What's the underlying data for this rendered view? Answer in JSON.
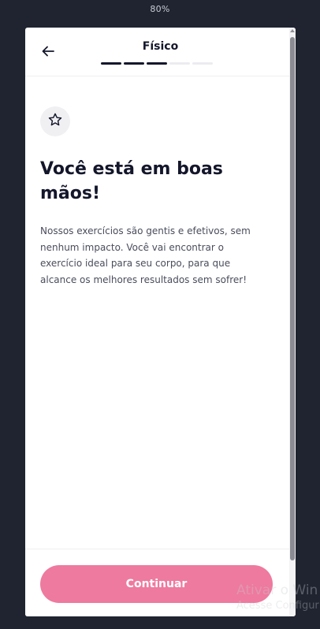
{
  "zoom": "80%",
  "header": {
    "title": "Físico",
    "progress_total_steps": 5,
    "progress_completed_steps": 3
  },
  "main": {
    "icon": "star-icon",
    "title": "Você está em boas mãos!",
    "body": "Nossos exercícios são gentis e efetivos, sem nenhum impacto. Você vai encontrar o exercício ideal para seu corpo, para que alcance os melhores resultados sem sofrer!"
  },
  "footer": {
    "continue_label": "Continuar"
  },
  "watermark": {
    "line1": "Ativar o Win",
    "line2": "Acesse Configur"
  },
  "colors": {
    "background": "#1f2430",
    "accent": "#ee7a9f",
    "text_dark": "#14172b",
    "text_body": "#4a4d5c"
  }
}
